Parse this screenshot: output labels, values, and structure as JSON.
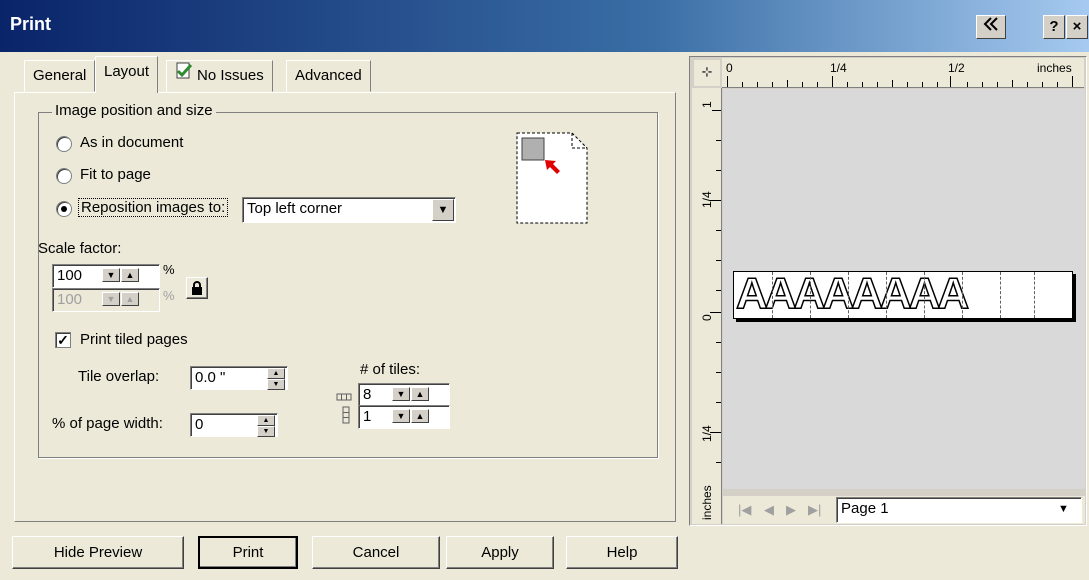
{
  "window": {
    "title": "Print",
    "collapse_icon": "double-left-arrow-icon",
    "help_label": "?",
    "close_label": "×"
  },
  "tabs": [
    {
      "label": "General"
    },
    {
      "label": "Layout"
    },
    {
      "label": "No Issues",
      "icon": "check-document-icon"
    },
    {
      "label": "Advanced"
    }
  ],
  "layout": {
    "group_title": "Image position and size",
    "radio_as_in_document": "As in document",
    "radio_fit_to_page": "Fit to page",
    "radio_reposition": "Reposition images to:",
    "reposition_value": "Top left corner",
    "selected_option": "Reposition images to:",
    "scale_label": "Scale factor:",
    "scale_x": "100",
    "scale_y": "100",
    "percent": "%",
    "lock_icon": "lock-icon",
    "print_tiled_label": "Print tiled pages",
    "print_tiled_checked": true,
    "tile_overlap_label": "Tile overlap:",
    "tile_overlap_value": "0.0 \"",
    "page_width_label": "% of page width:",
    "page_width_value": "0",
    "tiles_label": "# of tiles:",
    "tiles_horizontal": "8",
    "tiles_vertical": "1"
  },
  "preview": {
    "ruler_top_labels": [
      "0",
      "1/4",
      "1/2",
      "inches"
    ],
    "ruler_left_labels": [
      "1",
      "1/4",
      "0",
      "1/4",
      "inches"
    ],
    "tile_text": "AAAAAAAA",
    "page_select": "Page 1"
  },
  "buttons": {
    "hide_preview": "Hide Preview",
    "print": "Print",
    "cancel": "Cancel",
    "apply": "Apply",
    "help": "Help"
  }
}
